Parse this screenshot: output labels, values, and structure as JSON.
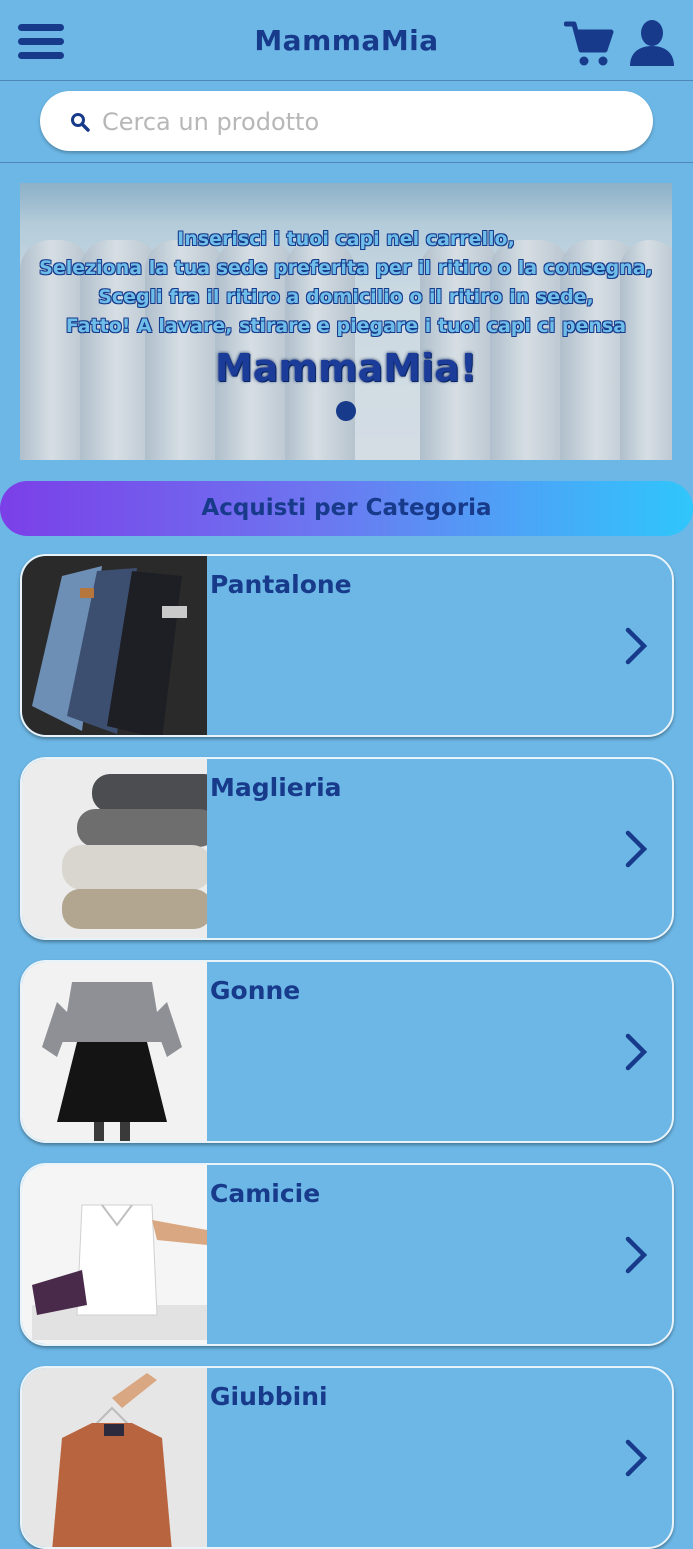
{
  "header": {
    "title": "MammaMia"
  },
  "search": {
    "placeholder": "Cerca un prodotto"
  },
  "banner": {
    "lines": [
      "Inserisci i tuoi capi nel carrello,",
      "Seleziona la tua sede preferita per il ritiro o la consegna,",
      "Scegli fra il ritiro a domicilio o il ritiro in sede,",
      "Fatto! A lavare, stirare e piegare i tuoi capi ci pensa"
    ],
    "brand": "MammaMia!"
  },
  "section": {
    "title": "Acquisti per Categoria"
  },
  "categories": [
    {
      "label": "Pantalone"
    },
    {
      "label": "Maglieria"
    },
    {
      "label": "Gonne"
    },
    {
      "label": "Camicie"
    },
    {
      "label": "Giubbini"
    }
  ],
  "colors": {
    "background": "#6cb7e6",
    "primary": "#173a8b",
    "gradient_start": "#7b3fe8",
    "gradient_end": "#2fc6fb"
  }
}
